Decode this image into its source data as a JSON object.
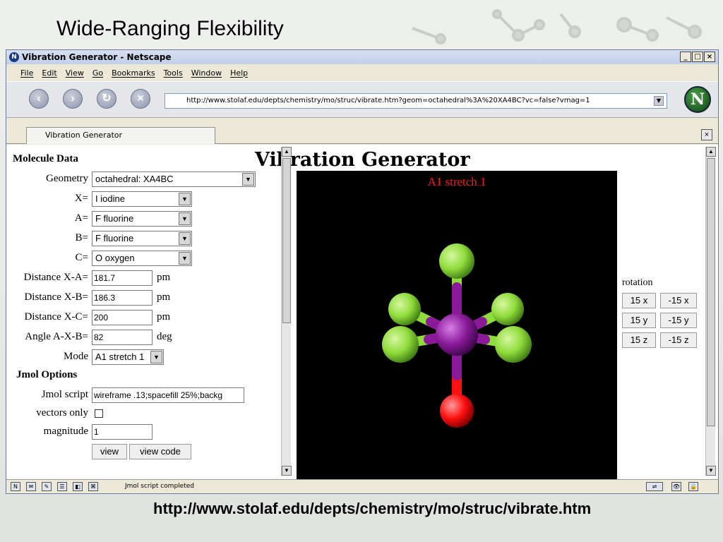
{
  "slide": {
    "title": "Wide-Ranging Flexibility",
    "footer_url": "http://www.stolaf.edu/depts/chemistry/mo/struc/vibrate.htm"
  },
  "window": {
    "title": "Vibration Generator - Netscape",
    "controls": [
      "_",
      "□",
      "×"
    ]
  },
  "menu": [
    "File",
    "Edit",
    "View",
    "Go",
    "Bookmarks",
    "Tools",
    "Window",
    "Help"
  ],
  "nav": {
    "back_icon": "back-arrow-icon",
    "forward_icon": "forward-arrow-icon",
    "reload_icon": "reload-icon",
    "stop_icon": "stop-icon",
    "url": "http://www.stolaf.edu/depts/chemistry/mo/struc/vibrate.htm?geom=octahedral%3A%20XA4BC?vc=false?vmag=1",
    "logo": "N"
  },
  "tab": {
    "label": "Vibration Generator"
  },
  "page": {
    "heading": "Vibration Generator",
    "molecule_section": "Molecule Data",
    "fields": {
      "geometry_label": "Geometry",
      "geometry_value": "octahedral: XA4BC",
      "x_label": "X=",
      "x_value": "I iodine",
      "a_label": "A=",
      "a_value": "F fluorine",
      "b_label": "B=",
      "b_value": "F fluorine",
      "c_label": "C=",
      "c_value": "O oxygen",
      "dxa_label": "Distance X-A=",
      "dxa_value": "181.7",
      "dxb_label": "Distance X-B=",
      "dxb_value": "186.3",
      "dxc_label": "Distance X-C=",
      "dxc_value": "200",
      "angle_label": "Angle A-X-B=",
      "angle_value": "82",
      "unit_pm": "pm",
      "unit_deg": "deg",
      "mode_label": "Mode",
      "mode_value": "A1 stretch 1"
    },
    "jmol_section": "Jmol Options",
    "jmol": {
      "script_label": "Jmol script",
      "script_value": "wireframe .13;spacefill 25%;backg",
      "vectors_label": "vectors only",
      "vectors_checked": false,
      "magnitude_label": "magnitude",
      "magnitude_value": "1"
    },
    "buttons": {
      "view": "view",
      "view_code": "view code"
    },
    "viewer_label": "A1 stretch 1",
    "rotation": {
      "label": "rotation",
      "buttons": [
        "15 x",
        "-15 x",
        "15 y",
        "-15 y",
        "15 z",
        "-15 z"
      ]
    }
  },
  "status": {
    "text": "Jmol script completed"
  },
  "colors": {
    "central_atom": "#8a1a9a",
    "fluorine": "#8fdc3c",
    "oxygen": "#ff1010",
    "viewer_bg": "#000000",
    "mode_label": "#ff1a1a"
  }
}
